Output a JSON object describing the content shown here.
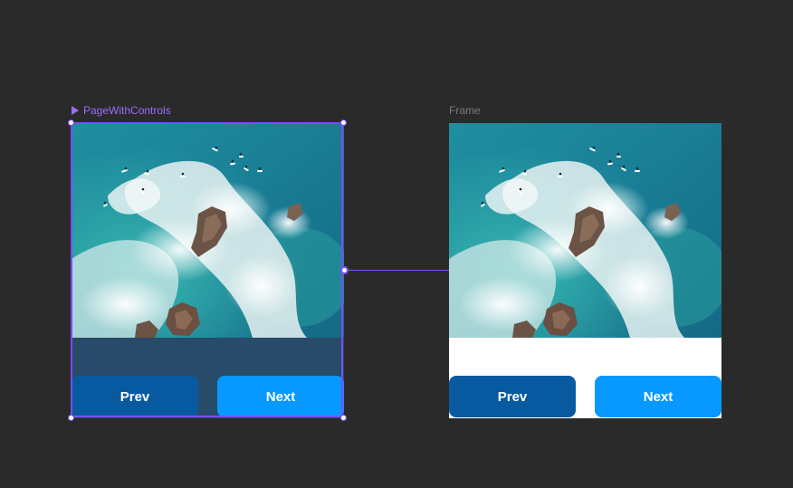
{
  "canvas": {
    "background": "#2a2a2a",
    "accent": "#7b4dff"
  },
  "left_frame": {
    "name": "PageWithControls",
    "icon": "play-icon",
    "prev_label": "Prev",
    "next_label": "Next",
    "background": "#274b68"
  },
  "right_frame": {
    "name": "Frame",
    "prev_label": "Prev",
    "next_label": "Next",
    "background": "#ffffff"
  },
  "buttons": {
    "prev_color": "#075aa0",
    "next_color": "#0799ff"
  }
}
